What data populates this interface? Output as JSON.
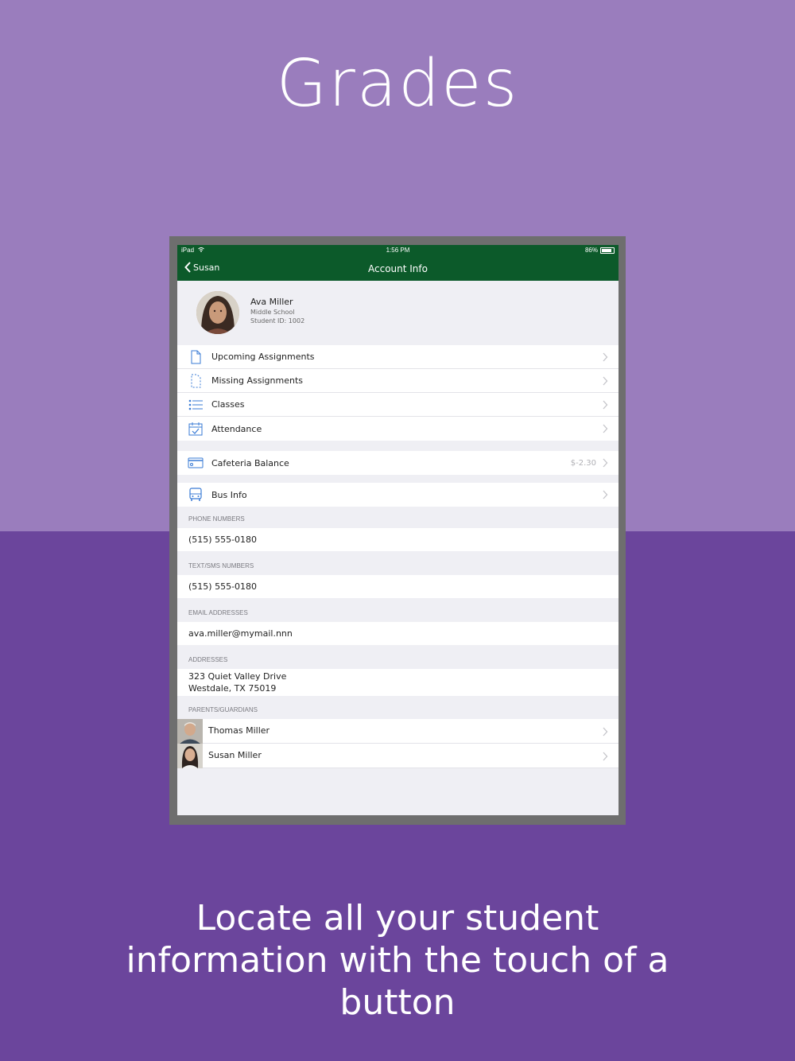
{
  "headline": "Grades",
  "caption": "Locate all your student information with the touch of a button",
  "statusbar": {
    "carrier": "iPad",
    "time": "1:56 PM",
    "battery": "86%",
    "battery_level": 0.86
  },
  "navbar": {
    "back_label": "Susan",
    "title": "Account Info"
  },
  "profile": {
    "name": "Ava Miller",
    "school": "Middle School",
    "student_id": "Student ID: 1002"
  },
  "menu": {
    "upcoming": "Upcoming Assignments",
    "missing": "Missing Assignments",
    "classes": "Classes",
    "attendance": "Attendance",
    "cafeteria": "Cafeteria Balance",
    "cafeteria_value": "$-2.30",
    "bus": "Bus Info"
  },
  "sections": {
    "phone_header": "PHONE NUMBERS",
    "phone": "(515) 555-0180",
    "sms_header": "TEXT/SMS NUMBERS",
    "sms": "(515) 555-0180",
    "email_header": "EMAIL ADDRESSES",
    "email": "ava.miller@mymail.nnn",
    "address_header": "ADDRESSES",
    "address_line1": "323 Quiet Valley Drive",
    "address_line2": "Westdale, TX 75019",
    "guardians_header": "PARENTS/GUARDIANS"
  },
  "guardians": [
    {
      "name": "Thomas Miller"
    },
    {
      "name": "Susan Miller"
    }
  ],
  "colors": {
    "bg_top": "#9a7dbd",
    "bg_bottom": "#6b459c",
    "nav_green": "#0c5a2a",
    "icon_blue": "#3a7bd5"
  }
}
